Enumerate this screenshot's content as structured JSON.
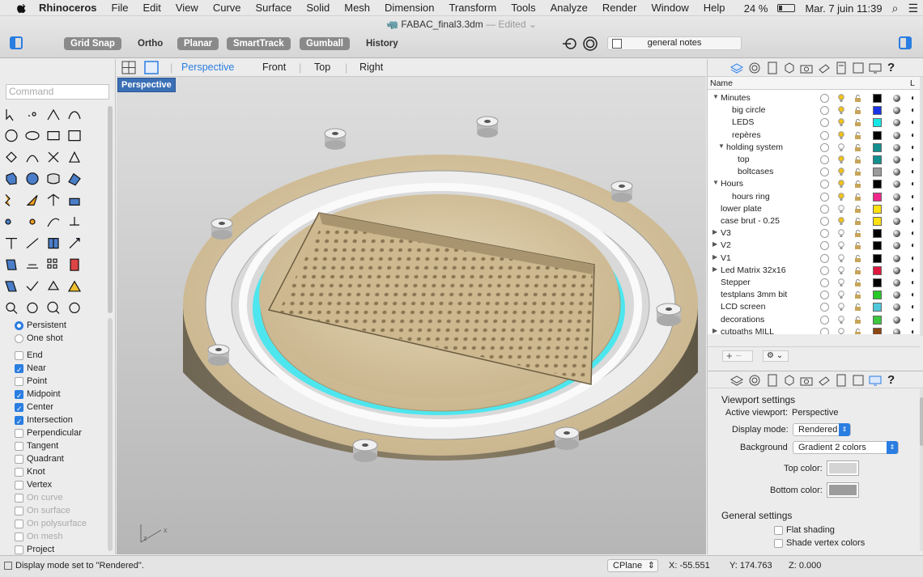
{
  "menubar": {
    "app": "Rhinoceros",
    "items": [
      "File",
      "Edit",
      "View",
      "Curve",
      "Surface",
      "Solid",
      "Mesh",
      "Dimension",
      "Transform",
      "Tools",
      "Analyze",
      "Render",
      "Window",
      "Help"
    ],
    "battery": "24 %",
    "datetime": "Mar. 7 juin  11:39"
  },
  "window": {
    "title": "FABAC_final3.3dm",
    "edited": "— Edited ⌄"
  },
  "toolbar": {
    "grid_snap": "Grid Snap",
    "ortho": "Ortho",
    "planar": "Planar",
    "smarttrack": "SmartTrack",
    "gumball": "Gumball",
    "history": "History",
    "layer": "general notes"
  },
  "command": {
    "placeholder": "Command"
  },
  "osnaps": {
    "persistent": "Persistent",
    "one_shot": "One shot",
    "items": [
      {
        "label": "End",
        "checked": false,
        "disabled": false
      },
      {
        "label": "Near",
        "checked": true,
        "disabled": false
      },
      {
        "label": "Point",
        "checked": false,
        "disabled": false
      },
      {
        "label": "Midpoint",
        "checked": true,
        "disabled": false
      },
      {
        "label": "Center",
        "checked": true,
        "disabled": false
      },
      {
        "label": "Intersection",
        "checked": true,
        "disabled": false
      },
      {
        "label": "Perpendicular",
        "checked": false,
        "disabled": false
      },
      {
        "label": "Tangent",
        "checked": false,
        "disabled": false
      },
      {
        "label": "Quadrant",
        "checked": false,
        "disabled": false
      },
      {
        "label": "Knot",
        "checked": false,
        "disabled": false
      },
      {
        "label": "Vertex",
        "checked": false,
        "disabled": false
      },
      {
        "label": "On curve",
        "checked": false,
        "disabled": true
      },
      {
        "label": "On surface",
        "checked": false,
        "disabled": true
      },
      {
        "label": "On polysurface",
        "checked": false,
        "disabled": true
      },
      {
        "label": "On mesh",
        "checked": false,
        "disabled": true
      },
      {
        "label": "Project",
        "checked": false,
        "disabled": false
      }
    ]
  },
  "viewport_tabs": [
    "Perspective",
    "Front",
    "Top",
    "Right"
  ],
  "viewport": {
    "label": "Perspective"
  },
  "layers": {
    "header_name": "Name",
    "header_last": "L",
    "rows": [
      {
        "name": "Minutes",
        "indent": 0,
        "expand": "down",
        "color": "#000000",
        "bulb": "on"
      },
      {
        "name": "big circle",
        "indent": 2,
        "expand": "",
        "color": "#1a33e6",
        "bulb": "on"
      },
      {
        "name": "LEDS",
        "indent": 2,
        "expand": "",
        "color": "#18e6e6",
        "bulb": "on"
      },
      {
        "name": "repères",
        "indent": 2,
        "expand": "",
        "color": "#000000",
        "bulb": "on"
      },
      {
        "name": "holding system",
        "indent": 1,
        "expand": "down",
        "color": "#138f8f",
        "bulb": "off"
      },
      {
        "name": "top",
        "indent": 3,
        "expand": "",
        "color": "#138f8f",
        "bulb": "on"
      },
      {
        "name": "boltcases",
        "indent": 3,
        "expand": "",
        "color": "#9b9b9b",
        "bulb": "on"
      },
      {
        "name": "Hours",
        "indent": 0,
        "expand": "down",
        "color": "#000000",
        "bulb": "on"
      },
      {
        "name": "hours ring",
        "indent": 2,
        "expand": "",
        "color": "#f0288c",
        "bulb": "on"
      },
      {
        "name": "lower plate",
        "indent": 0,
        "expand": "",
        "color": "#ffe010",
        "bulb": "off"
      },
      {
        "name": "case brut - 0.25",
        "indent": 0,
        "expand": "",
        "color": "#ffe010",
        "bulb": "on"
      },
      {
        "name": "V3",
        "indent": 0,
        "expand": "right",
        "color": "#000000",
        "bulb": "off"
      },
      {
        "name": "V2",
        "indent": 0,
        "expand": "right",
        "color": "#000000",
        "bulb": "off"
      },
      {
        "name": "V1",
        "indent": 0,
        "expand": "right",
        "color": "#000000",
        "bulb": "off"
      },
      {
        "name": "Led Matrix 32x16",
        "indent": 0,
        "expand": "right",
        "color": "#e01840",
        "bulb": "off"
      },
      {
        "name": "Stepper",
        "indent": 0,
        "expand": "",
        "color": "#000000",
        "bulb": "off"
      },
      {
        "name": "testplans 3mm bit",
        "indent": 0,
        "expand": "",
        "color": "#28c828",
        "bulb": "off"
      },
      {
        "name": "LCD screen",
        "indent": 0,
        "expand": "",
        "color": "#50c8dc",
        "bulb": "off"
      },
      {
        "name": "decorations",
        "indent": 0,
        "expand": "",
        "color": "#3cc83c",
        "bulb": "off"
      },
      {
        "name": "cutpaths MILL",
        "indent": 0,
        "expand": "right",
        "color": "#8c4614",
        "bulb": "off"
      }
    ]
  },
  "viewport_settings": {
    "title": "Viewport settings",
    "active_label": "Active viewport:",
    "active_value": "Perspective",
    "display_label": "Display mode:",
    "display_value": "Rendered",
    "background_label": "Background",
    "background_value": "Gradient 2 colors",
    "top_color_label": "Top color:",
    "top_color": "#d4d4d4",
    "bottom_color_label": "Bottom color:",
    "bottom_color": "#9c9c9c",
    "general_title": "General settings",
    "flat_shading": "Flat shading",
    "shade_vertex": "Shade vertex colors"
  },
  "status": {
    "message": "Display mode set to \"Rendered\".",
    "cplane": "CPlane",
    "x": "X: -55.551",
    "y": "Y: 174.763",
    "z": "Z: 0.000"
  },
  "colors": {
    "accent": "#2a7de1",
    "wood": "#d8c4a0",
    "ring": "#ebebeb",
    "led": "#5ce8f0"
  }
}
